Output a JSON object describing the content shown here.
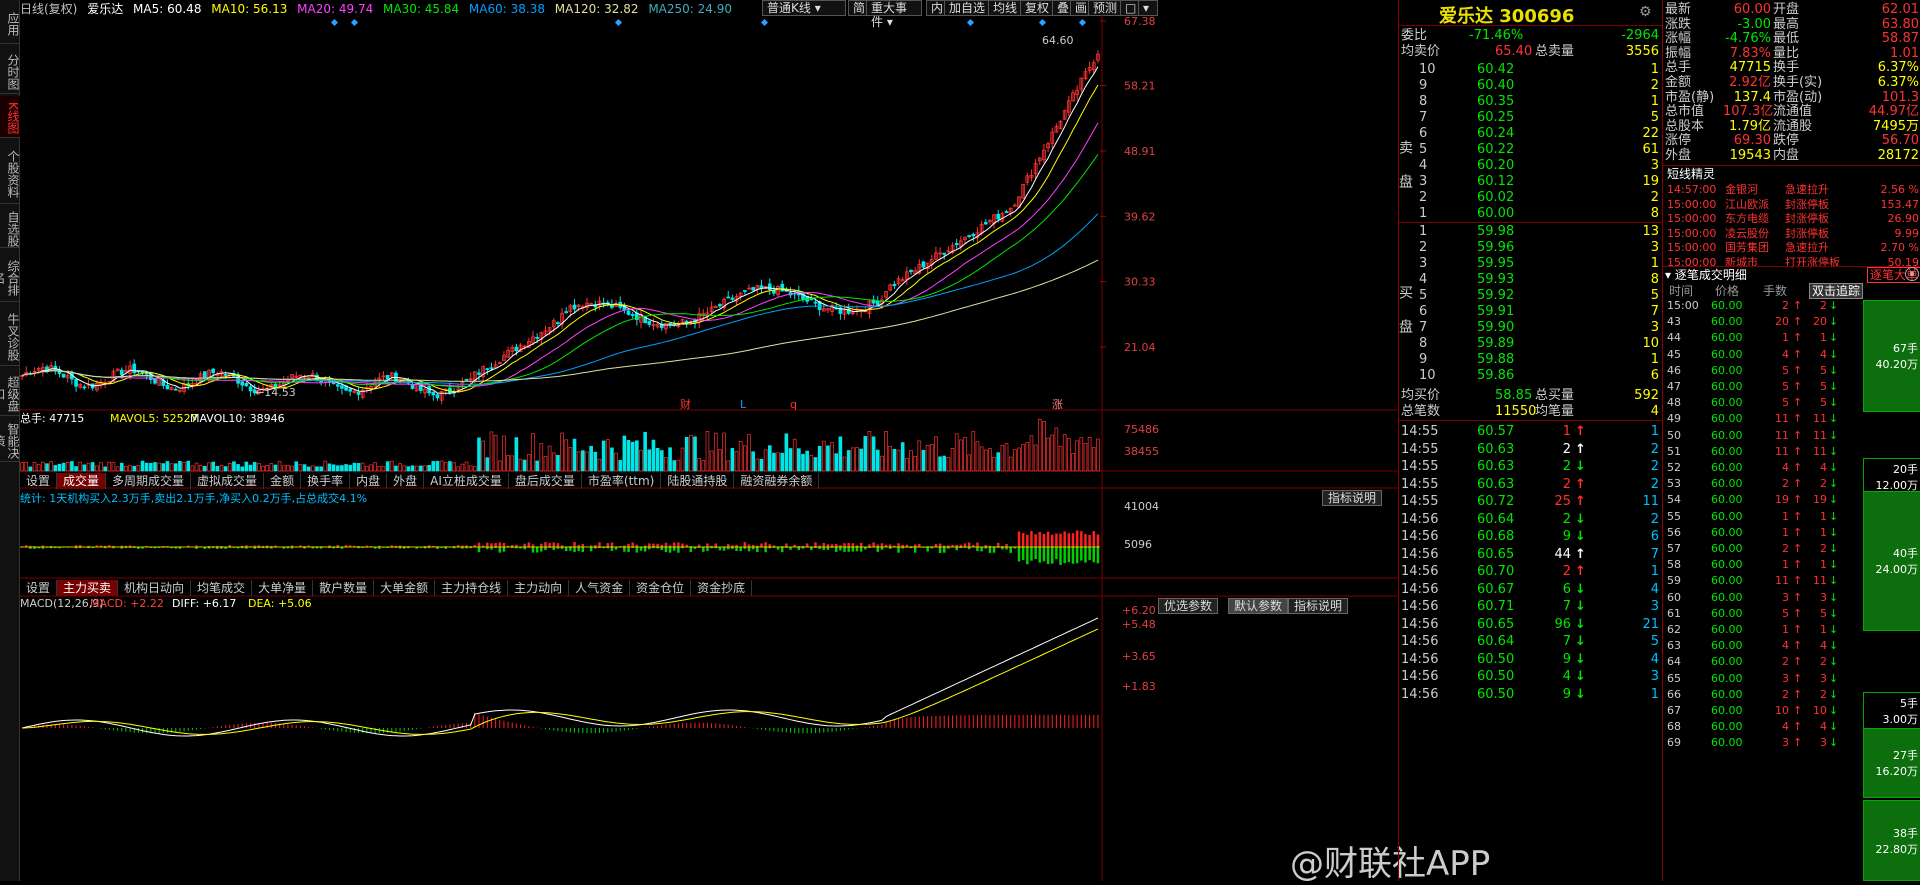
{
  "colors": {
    "up": "#ff3232",
    "down": "#00e6e6",
    "ma5": "#ffffff",
    "ma10": "#ffff00",
    "ma20": "#ff40ff",
    "ma30": "#00e600",
    "ma60": "#00a0ff",
    "ma120": "#e0e0a0"
  },
  "nav": {
    "tabs": [
      "应用",
      "分时图",
      "K线图",
      "个股资料",
      "自选股",
      "综合排名",
      "牛叉诊股",
      "超级盘口",
      "智能决策"
    ],
    "active": 2
  },
  "header": {
    "period": "日线(复权)",
    "name": "爱乐达",
    "ma5": "MA5: 60.48",
    "ma10": "MA10: 56.13",
    "ma20": "MA20: 49.74",
    "ma30": "MA30: 45.84",
    "ma60": "MA60: 38.38",
    "ma120": "MA120: 32.82",
    "ma250": "MA250: 24.90"
  },
  "toolbar": {
    "kline_type": "普通K线",
    "bar2": "简",
    "event": "重大事件",
    "b_nei": "内",
    "b_zixuan": "加自选",
    "b_junxian": "均线",
    "b_fuquan": "复权",
    "b_die": "叠",
    "b_hua": "画",
    "b_yuce": "预测",
    "b_sq": "□"
  },
  "price_axis": [
    "67.38",
    "58.21",
    "48.91",
    "39.62",
    "30.33",
    "21.04"
  ],
  "price_marks": {
    "high": "64.60",
    "low": "14.53",
    "f_cai": "财",
    "f_l": "L",
    "f_q": "q",
    "f_zhang": "涨"
  },
  "volume": {
    "label": "总手: 47715",
    "mavol5": "MAVOL5: 52527",
    "mavol10": "MAVOL10: 38946",
    "axis": [
      "75486",
      "38455"
    ]
  },
  "vol_tabs": [
    "设置",
    "成交量",
    "多周期成交量",
    "虚拟成交量",
    "金额",
    "换手率",
    "内盘",
    "外盘",
    "AI立桩成交量",
    "盘后成交量",
    "市盈率(ttm)",
    "陆股通持股",
    "融资融券余额"
  ],
  "vol_tab_active": 1,
  "flow": {
    "summary": "统计: 1天机构买入2.3万手,卖出2.1万手,净买入0.2万手,占总成交4.1%",
    "axis": [
      "41004",
      "5096"
    ],
    "help": "指标说明"
  },
  "flow_tabs": [
    "设置",
    "主力买卖",
    "机构日动向",
    "均笔成交",
    "大单净量",
    "散户数量",
    "大单金额",
    "主力持仓线",
    "主力动向",
    "人气资金",
    "资金仓位",
    "资金抄底"
  ],
  "flow_tab_active": 1,
  "macd": {
    "label": "MACD(12,26,9)",
    "macd": "MACD: +2.22",
    "diff": "DIFF: +6.17",
    "dea": "DEA: +5.06",
    "axis": [
      "+6.20",
      "+5.48",
      "+3.65",
      "+1.83"
    ],
    "btn1": "优选参数",
    "btn2": "默认参数",
    "btn3": "指标说明"
  },
  "quote": {
    "title": "爱乐达 300696",
    "weibi_label": "委比",
    "weibi": "-71.46%",
    "weicha": "-2964",
    "jmj_label": "均卖价",
    "jmj": "65.40",
    "zml_label": "总卖量",
    "zml": "3556",
    "sell_side": "卖盘",
    "buy_side": "买盘",
    "asks": [
      [
        "10",
        "60.42",
        "1"
      ],
      [
        "9",
        "60.40",
        "2"
      ],
      [
        "8",
        "60.35",
        "1"
      ],
      [
        "7",
        "60.25",
        "5"
      ],
      [
        "6",
        "60.24",
        "22"
      ],
      [
        "5",
        "60.22",
        "61"
      ],
      [
        "4",
        "60.20",
        "3"
      ],
      [
        "3",
        "60.12",
        "19"
      ],
      [
        "2",
        "60.02",
        "2"
      ],
      [
        "1",
        "60.00",
        "8"
      ]
    ],
    "bids": [
      [
        "1",
        "59.98",
        "13"
      ],
      [
        "2",
        "59.96",
        "3"
      ],
      [
        "3",
        "59.95",
        "1"
      ],
      [
        "4",
        "59.93",
        "8"
      ],
      [
        "5",
        "59.92",
        "5"
      ],
      [
        "6",
        "59.91",
        "7"
      ],
      [
        "7",
        "59.90",
        "3"
      ],
      [
        "8",
        "59.89",
        "10"
      ],
      [
        "9",
        "59.88",
        "1"
      ],
      [
        "10",
        "59.86",
        "6"
      ]
    ],
    "jmrj_label": "均买价",
    "jmrj": "58.85",
    "zmrl_label": "总买量",
    "zmrl": "592",
    "zbs_label": "总笔数",
    "zbs": "11550",
    "jbl_label": "均笔量",
    "jbl": "4",
    "ticks": [
      [
        "14:55",
        "60.57",
        "1",
        "up",
        "1"
      ],
      [
        "14:55",
        "60.63",
        "2",
        "upw",
        "2"
      ],
      [
        "14:55",
        "60.63",
        "2",
        "dn",
        "2"
      ],
      [
        "14:55",
        "60.63",
        "2",
        "up",
        "2"
      ],
      [
        "14:55",
        "60.72",
        "25",
        "up",
        "11"
      ],
      [
        "14:56",
        "60.64",
        "2",
        "dn",
        "2"
      ],
      [
        "14:56",
        "60.68",
        "9",
        "dn",
        "6"
      ],
      [
        "14:56",
        "60.65",
        "44",
        "upw",
        "7"
      ],
      [
        "14:56",
        "60.70",
        "2",
        "up",
        "1"
      ],
      [
        "14:56",
        "60.67",
        "6",
        "dn",
        "4"
      ],
      [
        "14:56",
        "60.71",
        "7",
        "dn",
        "3"
      ],
      [
        "14:56",
        "60.65",
        "96",
        "dn",
        "21"
      ],
      [
        "14:56",
        "60.64",
        "7",
        "dn",
        "5"
      ],
      [
        "14:56",
        "60.50",
        "9",
        "dn",
        "4"
      ],
      [
        "14:56",
        "60.50",
        "4",
        "dn",
        "3"
      ],
      [
        "14:56",
        "60.50",
        "9",
        "dn",
        "1"
      ]
    ]
  },
  "stats": [
    [
      "最新",
      "60.00",
      "开盘",
      "62.01"
    ],
    [
      "涨跌",
      "-3.00",
      "最高",
      "63.80"
    ],
    [
      "涨幅",
      "-4.76%",
      "最低",
      "58.87"
    ],
    [
      "振幅",
      "7.83%",
      "量比",
      "1.01"
    ],
    [
      "总手",
      "47715",
      "换手",
      "6.37%"
    ],
    [
      "金额",
      "2.92亿",
      "换手(实)",
      "6.37%"
    ],
    [
      "市盈(静)",
      "137.4",
      "市盈(动)",
      "101.3"
    ],
    [
      "总市值",
      "107.3亿",
      "流通值",
      "44.97亿"
    ],
    [
      "总股本",
      "1.79亿",
      "流通股",
      "7495万"
    ],
    [
      "涨停",
      "69.30",
      "跌停",
      "56.70"
    ],
    [
      "外盘",
      "19543",
      "内盘",
      "28172"
    ]
  ],
  "elf": {
    "title": "短线精灵",
    "rows": [
      [
        "14:57:00",
        "金银河",
        "急速拉升",
        "2.56 %"
      ],
      [
        "15:00:00",
        "江山欧派",
        "封涨停板",
        "153.47"
      ],
      [
        "15:00:00",
        "东方电缆",
        "封涨停板",
        "26.90"
      ],
      [
        "15:00:00",
        "凌云股份",
        "封涨停板",
        "9.99"
      ],
      [
        "15:00:00",
        "国芳集团",
        "急速拉升",
        "2.70 %"
      ],
      [
        "15:00:00",
        "新城市",
        "打开涨停板",
        "50.19"
      ]
    ]
  },
  "detail": {
    "title": "逐笔成交明细",
    "btn": "逐笔大单",
    "btn2": "双击追踪",
    "cols": [
      "时间",
      "价格",
      "手数"
    ],
    "rows": [
      [
        "15:00",
        "60.00",
        "2"
      ],
      [
        "43",
        "60.00",
        "20"
      ],
      [
        "44",
        "60.00",
        "1"
      ],
      [
        "45",
        "60.00",
        "4"
      ],
      [
        "46",
        "60.00",
        "5"
      ],
      [
        "47",
        "60.00",
        "5"
      ],
      [
        "48",
        "60.00",
        "5"
      ],
      [
        "49",
        "60.00",
        "11"
      ],
      [
        "50",
        "60.00",
        "11"
      ],
      [
        "51",
        "60.00",
        "11"
      ],
      [
        "52",
        "60.00",
        "4"
      ],
      [
        "53",
        "60.00",
        "2"
      ],
      [
        "54",
        "60.00",
        "19"
      ],
      [
        "55",
        "60.00",
        "1"
      ],
      [
        "56",
        "60.00",
        "1"
      ],
      [
        "57",
        "60.00",
        "2"
      ],
      [
        "58",
        "60.00",
        "1"
      ],
      [
        "59",
        "60.00",
        "11"
      ],
      [
        "60",
        "60.00",
        "3"
      ],
      [
        "61",
        "60.00",
        "5"
      ],
      [
        "62",
        "60.00",
        "1"
      ],
      [
        "63",
        "60.00",
        "4"
      ],
      [
        "64",
        "60.00",
        "2"
      ],
      [
        "65",
        "60.00",
        "3"
      ],
      [
        "66",
        "60.00",
        "2"
      ],
      [
        "67",
        "60.00",
        "10"
      ],
      [
        "68",
        "60.00",
        "4"
      ],
      [
        "69",
        "60.00",
        "3"
      ]
    ],
    "big": [
      [
        "67手",
        "40.20万"
      ],
      [
        "20手",
        "12.00万"
      ],
      [
        "40手",
        "24.00万"
      ],
      [
        "5手",
        "3.00万"
      ],
      [
        "27手",
        "16.20万"
      ],
      [
        "38手",
        "22.80万"
      ]
    ]
  },
  "watermark": "@财联社APP"
}
